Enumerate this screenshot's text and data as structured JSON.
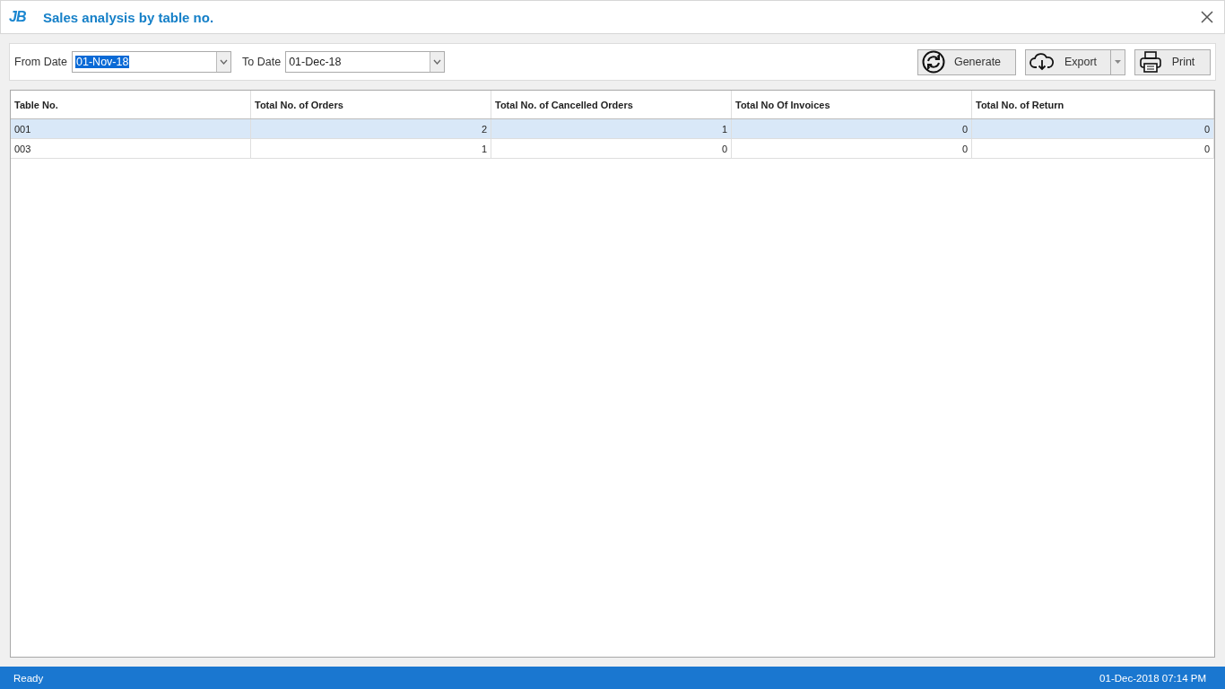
{
  "window": {
    "logo": "JB",
    "title": "Sales analysis by table no."
  },
  "filters": [
    {
      "label": "From Date",
      "value": "01-Nov-18",
      "text_selected": true
    },
    {
      "label": "To Date",
      "value": "01-Dec-18",
      "text_selected": false
    }
  ],
  "buttons": [
    {
      "kind": "generate",
      "label": "Generate",
      "split": false
    },
    {
      "kind": "export",
      "label": "Export",
      "split": true
    },
    {
      "kind": "print",
      "label": "Print",
      "split": false
    }
  ],
  "table": {
    "columns": [
      "Table No.",
      "Total No. of Orders",
      "Total No. of Cancelled Orders",
      "Total No Of Invoices",
      "Total No. of Return"
    ],
    "rows": [
      {
        "selected": true,
        "cells": [
          "001",
          "2",
          "1",
          "0",
          "0"
        ]
      },
      {
        "selected": false,
        "cells": [
          "003",
          "1",
          "0",
          "0",
          "0"
        ]
      }
    ]
  },
  "status_bar": {
    "status": "Ready",
    "datetime": "01-Dec-2018 07:14 PM"
  }
}
